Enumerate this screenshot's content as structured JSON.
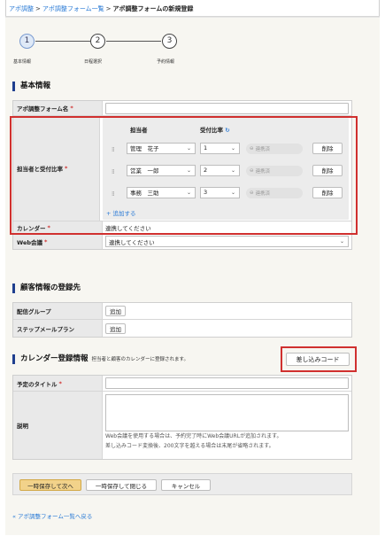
{
  "breadcrumb": {
    "root": "アポ調整",
    "separator": ">",
    "list": "アポ調整フォーム一覧",
    "current": "アポ調整フォームの新規登録"
  },
  "steps": [
    {
      "number": "1",
      "label": "基本情報",
      "active": true
    },
    {
      "number": "2",
      "label": "日程選択",
      "active": false
    },
    {
      "number": "3",
      "label": "予約情報",
      "active": false
    }
  ],
  "basic": {
    "heading": "基本情報",
    "form_name_label": "アポ調整フォーム名",
    "form_name_value": "",
    "staff_label": "担当者と受付比率",
    "staff_col": "担当者",
    "ratio_col": "受付比率",
    "refresh_icon": "refresh-icon",
    "staff_rows": [
      {
        "name": "管理　花子",
        "ratio": "1",
        "link": "連携済",
        "delete": "削除"
      },
      {
        "name": "営業　一郎",
        "ratio": "2",
        "link": "連携済",
        "delete": "削除"
      },
      {
        "name": "事務　三助",
        "ratio": "3",
        "link": "連携済",
        "delete": "削除"
      }
    ],
    "add_label": "+ 追加する",
    "calendar_label": "カレンダー",
    "calendar_value": "連携してください",
    "web_label": "Web会議",
    "web_value": "連携してください"
  },
  "customer": {
    "heading": "顧客情報の登録先",
    "group_label": "配信グループ",
    "group_button": "追加",
    "stepmail_label": "ステップメールプラン",
    "stepmail_button": "追加"
  },
  "calendar_reg": {
    "heading": "カレンダー登録情報",
    "note": "担当者と顧客のカレンダーに登録されます。",
    "insert_code": "差し込みコード",
    "title_label": "予定のタイトル",
    "title_value": "",
    "desc_label": "説明",
    "desc_value": "",
    "hint1": "Web会議を使用する場合は、予約完了時にWeb会議URLが追加されます。",
    "hint2": "差し込みコード変換後、200文字を越える場合は末尾が省略されます。"
  },
  "buttons": {
    "save_next": "一時保存して次へ",
    "save_close": "一時保存して閉じる",
    "cancel": "キャンセル"
  },
  "back_link": "« アポ調整フォーム一覧へ戻る",
  "required_mark": "*",
  "colors": {
    "accent": "#2b7bd6",
    "required": "#d0302f",
    "highlight_box": "#d0302f",
    "primary_button": "#f2d28a"
  }
}
